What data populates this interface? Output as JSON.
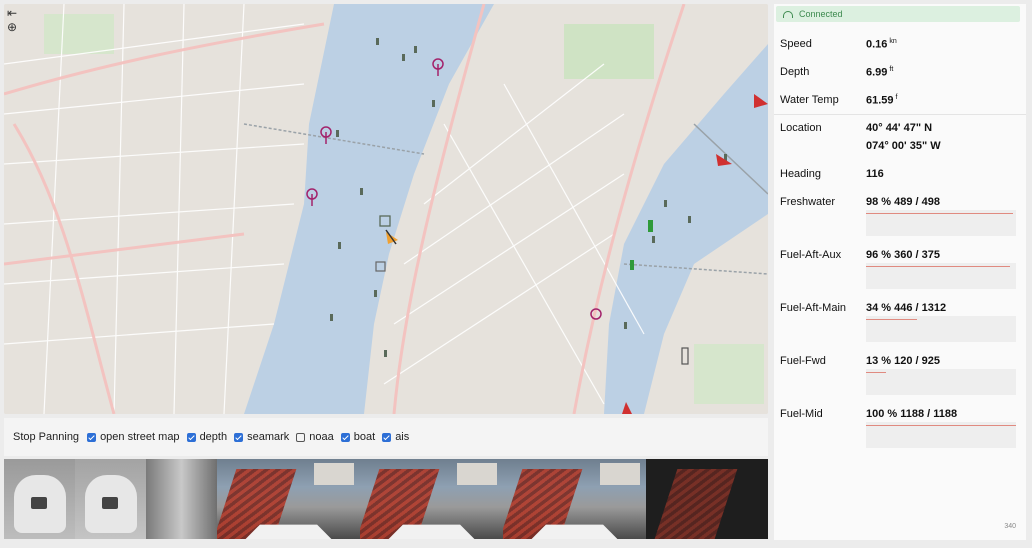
{
  "map": {
    "tools": {
      "collapse_icon": "arrow-collapse-icon",
      "locate_icon": "crosshair-icon"
    },
    "colors": {
      "land": "#e6e2dc",
      "water": "#bcd0e4",
      "park": "#cfe3c4",
      "road_major": "#f3c3c0",
      "road_minor": "#ffffff",
      "ais_target": "#5a6a5a",
      "seamark": "#a3226b",
      "boat": "#f0a030"
    }
  },
  "layers": {
    "stop_label": "Stop Panning",
    "items": [
      {
        "label": "open street map",
        "checked": true
      },
      {
        "label": "depth",
        "checked": true
      },
      {
        "label": "seamark",
        "checked": true
      },
      {
        "label": "noaa",
        "checked": false
      },
      {
        "label": "boat",
        "checked": true
      },
      {
        "label": "ais",
        "checked": true
      }
    ]
  },
  "status": {
    "label": "Connected",
    "color": "#3d8a4f"
  },
  "instruments": {
    "speed": {
      "label": "Speed",
      "value": "0.16",
      "unit": "kn"
    },
    "depth": {
      "label": "Depth",
      "value": "6.99",
      "unit": "ft"
    },
    "water_temp": {
      "label": "Water Temp",
      "value": "61.59",
      "unit": "f"
    },
    "location": {
      "label": "Location",
      "lat": "40° 44' 47\" N",
      "lon": "074° 00' 35\" W"
    },
    "heading": {
      "label": "Heading",
      "value": "116"
    }
  },
  "tanks": [
    {
      "label": "Freshwater",
      "value": "98 % 489 / 498",
      "percent": 98
    },
    {
      "label": "Fuel-Aft-Aux",
      "value": "96 % 360 / 375",
      "percent": 96
    },
    {
      "label": "Fuel-Aft-Main",
      "value": "34 % 446 / 1312",
      "percent": 34
    },
    {
      "label": "Fuel-Fwd",
      "value": "13 % 120 / 925",
      "percent": 13
    },
    {
      "label": "Fuel-Mid",
      "value": "100 % 1188 / 1188",
      "percent": 100
    }
  ],
  "footer": {
    "corner_text": "340"
  }
}
